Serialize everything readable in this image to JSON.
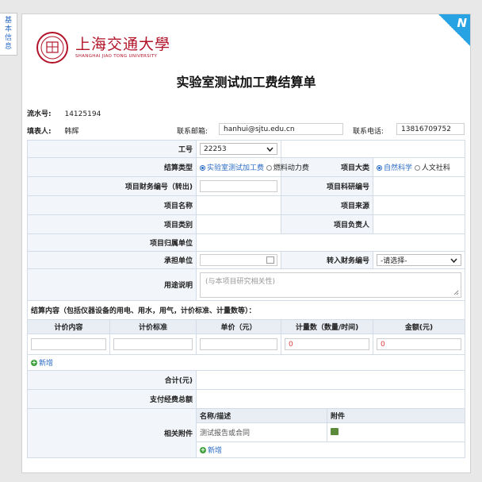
{
  "side_tab": {
    "label": [
      "基",
      "本",
      "信",
      "息"
    ]
  },
  "corner": {
    "glyph": "N"
  },
  "logo": {
    "cn": "上海交通大學",
    "en": "SHANGHAI JIAO TONG UNIVERSITY"
  },
  "title": "实验室测试加工费结算单",
  "header": {
    "serial_label": "流水号:",
    "serial_value": "14125194",
    "filler_label": "填表人:",
    "filler_value": "韩辉",
    "email_label": "联系邮箱:",
    "email_value": "hanhui@sjtu.edu.cn",
    "phone_label": "联系电话:",
    "phone_value": "13816709752"
  },
  "form": {
    "job_no_label": "工号",
    "job_no_value": "22253",
    "settle_type_label": "结算类型",
    "settle_type_options": [
      "实验室测试加工费",
      "燃料动力费"
    ],
    "project_cat_label": "项目大类",
    "project_cat_options": [
      "自然科学",
      "人文社科"
    ],
    "finance_no_label": "项目财务编号（转出)",
    "research_no_label": "项目科研编号",
    "project_name_label": "项目名称",
    "project_source_label": "项目来源",
    "project_type_label": "项目类别",
    "project_leader_label": "项目负责人",
    "project_unit_label": "项目归属单位",
    "undertake_label": "承担单位",
    "transfer_label": "转入财务编号",
    "transfer_value": "-请选择-",
    "purpose_label": "用途说明",
    "purpose_placeholder": "(与本项目研究相关性)"
  },
  "settle": {
    "section_label": "结算内容（包括仪器设备的用电、用水，用气，计价标准、计量数等）：",
    "columns": [
      "计价内容",
      "计价标准",
      "单价（元）",
      "计量数（数量/时间)",
      "金额(元)"
    ],
    "qty_value": "0",
    "amount_value": "0",
    "add_label": "新增"
  },
  "totals": {
    "sum_label": "合计(元)",
    "paid_label": "支付经费总额"
  },
  "attachments": {
    "label": "相关附件",
    "col_name": "名称/描述",
    "col_file": "附件",
    "row_name": "测试报告或合同",
    "add_label": "新增"
  },
  "colors": {
    "accent": "#2b6cc4",
    "brand": "#b2142a",
    "corner": "#27a3e3"
  }
}
